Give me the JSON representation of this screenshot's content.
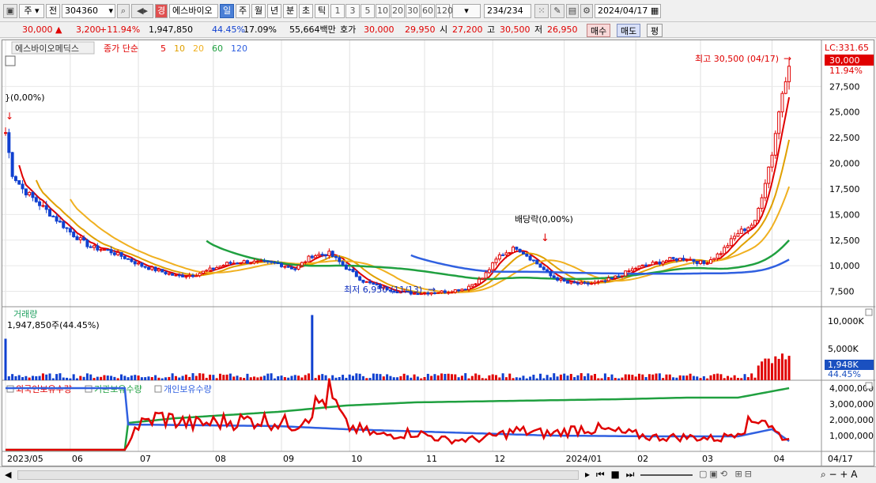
{
  "toolbar": {
    "market": "주",
    "prev_label": "전",
    "code": "304360",
    "badge": "경",
    "name": "에스바이오",
    "periods": [
      "일",
      "주",
      "월",
      "년",
      "분",
      "초",
      "틱"
    ],
    "intervals": [
      "1",
      "3",
      "5",
      "10",
      "20",
      "30",
      "60",
      "120"
    ],
    "count": "234",
    "count_total": "/234",
    "date": "2024/04/17"
  },
  "quote": {
    "price": "30,000",
    "arrow": "▲",
    "change": "3,200",
    "change_pct": "+11.94%",
    "volume": "1,947,850",
    "vol_ratio": "44.45%",
    "turnover": "17.09%",
    "amount": "55,664백만",
    "ask_label": "호가",
    "ask": "30,000",
    "bid": "29,950",
    "open_label": "시",
    "open": "27,200",
    "high_label": "고",
    "high": "30,500",
    "low_label": "저",
    "low": "26,950",
    "buy_label": "매수",
    "sell_label": "매도",
    "eval_label": "평"
  },
  "price_panel": {
    "stock_name": "에스바이오메딕스",
    "ma_label": "종가 단순",
    "ma_periods": [
      {
        "label": "5",
        "color": "#e00000"
      },
      {
        "label": "10",
        "color": "#e0a000"
      },
      {
        "label": "20",
        "color": "#f0b020"
      },
      {
        "label": "60",
        "color": "#20a040"
      },
      {
        "label": "120",
        "color": "#3060e0"
      }
    ],
    "lc_label": "LC:331.65",
    "current_tag": "30,000",
    "current_pct": "11.94%",
    "high_note": "최고 30,500 (04/17)",
    "low_note": "최저 6,950 (11/13)",
    "dividend_note": "배당락(0,00%)",
    "left_note": "}(0,00%)",
    "y_ticks": [
      "27,500",
      "25,000",
      "22,500",
      "20,000",
      "17,500",
      "15,000",
      "12,500",
      "10,000",
      "7,500"
    ]
  },
  "volume_panel": {
    "title": "거래량",
    "value": "1,947,850주(44.45%)",
    "y_ticks": [
      "10,000K",
      "5,000K"
    ],
    "current_tag": "1,948K",
    "current_pct": "44.45%"
  },
  "holding_panel": {
    "legend": [
      {
        "label": "외국인보유수량",
        "color": "#e00000"
      },
      {
        "label": "기관보유수량",
        "color": "#20a040"
      },
      {
        "label": "개인보유수량",
        "color": "#3060e0"
      }
    ],
    "y_ticks": [
      "4,000,000",
      "3,000,000",
      "2,000,000",
      "1,000,000"
    ]
  },
  "x_axis": {
    "labels": [
      "2023/05",
      "06",
      "07",
      "08",
      "09",
      "10",
      "11",
      "12",
      "2024/01",
      "02",
      "03",
      "04"
    ],
    "end_label": "04/17"
  },
  "chart_data": {
    "type": "line",
    "series": [
      {
        "name": "종가 단순 5",
        "kind": "close_ma5",
        "points": [
          [
            0,
            23000
          ],
          [
            2,
            19000
          ],
          [
            5,
            17500
          ],
          [
            10,
            16000
          ],
          [
            15,
            14500
          ],
          [
            20,
            13000
          ],
          [
            25,
            11800
          ],
          [
            30,
            11500
          ],
          [
            35,
            10800
          ],
          [
            40,
            10000
          ],
          [
            45,
            9500
          ],
          [
            50,
            9000
          ],
          [
            55,
            9100
          ],
          [
            60,
            9600
          ],
          [
            65,
            10200
          ],
          [
            70,
            10400
          ],
          [
            75,
            10300
          ],
          [
            80,
            10200
          ],
          [
            85,
            9700
          ],
          [
            90,
            11000
          ],
          [
            95,
            11200
          ],
          [
            100,
            9800
          ],
          [
            105,
            8500
          ],
          [
            110,
            7900
          ],
          [
            115,
            7500
          ],
          [
            120,
            7300
          ],
          [
            125,
            7400
          ],
          [
            130,
            7500
          ],
          [
            135,
            7800
          ],
          [
            140,
            8800
          ],
          [
            145,
            11000
          ],
          [
            150,
            11800
          ],
          [
            155,
            10500
          ],
          [
            160,
            9000
          ],
          [
            165,
            8300
          ],
          [
            170,
            8200
          ],
          [
            175,
            8400
          ],
          [
            180,
            9000
          ],
          [
            185,
            9800
          ],
          [
            190,
            10200
          ],
          [
            195,
            10600
          ],
          [
            200,
            10700
          ],
          [
            205,
            10200
          ],
          [
            210,
            11300
          ],
          [
            215,
            13200
          ],
          [
            220,
            14200
          ],
          [
            225,
            21000
          ],
          [
            228,
            27000
          ],
          [
            230,
            30000
          ]
        ]
      },
      {
        "name": "기관보유수량",
        "kind": "inst",
        "points": [
          [
            0,
            100000
          ],
          [
            35,
            100000
          ],
          [
            36,
            1800000
          ],
          [
            50,
            2100000
          ],
          [
            80,
            2500000
          ],
          [
            100,
            2900000
          ],
          [
            120,
            3100000
          ],
          [
            150,
            3200000
          ],
          [
            180,
            3300000
          ],
          [
            200,
            3400000
          ],
          [
            215,
            3400000
          ],
          [
            225,
            3800000
          ],
          [
            230,
            4000000
          ]
        ]
      },
      {
        "name": "개인보유수량",
        "kind": "indiv",
        "points": [
          [
            0,
            4000000
          ],
          [
            35,
            4000000
          ],
          [
            36,
            1700000
          ],
          [
            80,
            1600000
          ],
          [
            100,
            1400000
          ],
          [
            130,
            1200000
          ],
          [
            160,
            1000000
          ],
          [
            190,
            950000
          ],
          [
            215,
            950000
          ],
          [
            225,
            1400000
          ],
          [
            230,
            650000
          ]
        ]
      },
      {
        "name": "외국인보유수량",
        "kind": "foreign",
        "points": [
          [
            0,
            100000
          ],
          [
            35,
            100000
          ],
          [
            38,
            1500000
          ],
          [
            45,
            2200000
          ],
          [
            55,
            1700000
          ],
          [
            65,
            1900000
          ],
          [
            75,
            2000000
          ],
          [
            85,
            1700000
          ],
          [
            95,
            3600000
          ],
          [
            100,
            1600000
          ],
          [
            110,
            1000000
          ],
          [
            120,
            1200000
          ],
          [
            130,
            700000
          ],
          [
            140,
            800000
          ],
          [
            150,
            1300000
          ],
          [
            160,
            1100000
          ],
          [
            170,
            1500000
          ],
          [
            180,
            1200000
          ],
          [
            190,
            900000
          ],
          [
            200,
            900000
          ],
          [
            210,
            800000
          ],
          [
            218,
            1700000
          ],
          [
            222,
            2300000
          ],
          [
            226,
            1200000
          ],
          [
            230,
            700000
          ]
        ]
      }
    ],
    "volume_spikes": [
      [
        0,
        7000
      ],
      [
        90,
        11000
      ],
      [
        228,
        4500
      ]
    ],
    "price_ylim": [
      6000,
      32000
    ],
    "volume_ylim": [
      0,
      12000
    ],
    "holding_ylim": [
      0,
      4400000
    ]
  }
}
